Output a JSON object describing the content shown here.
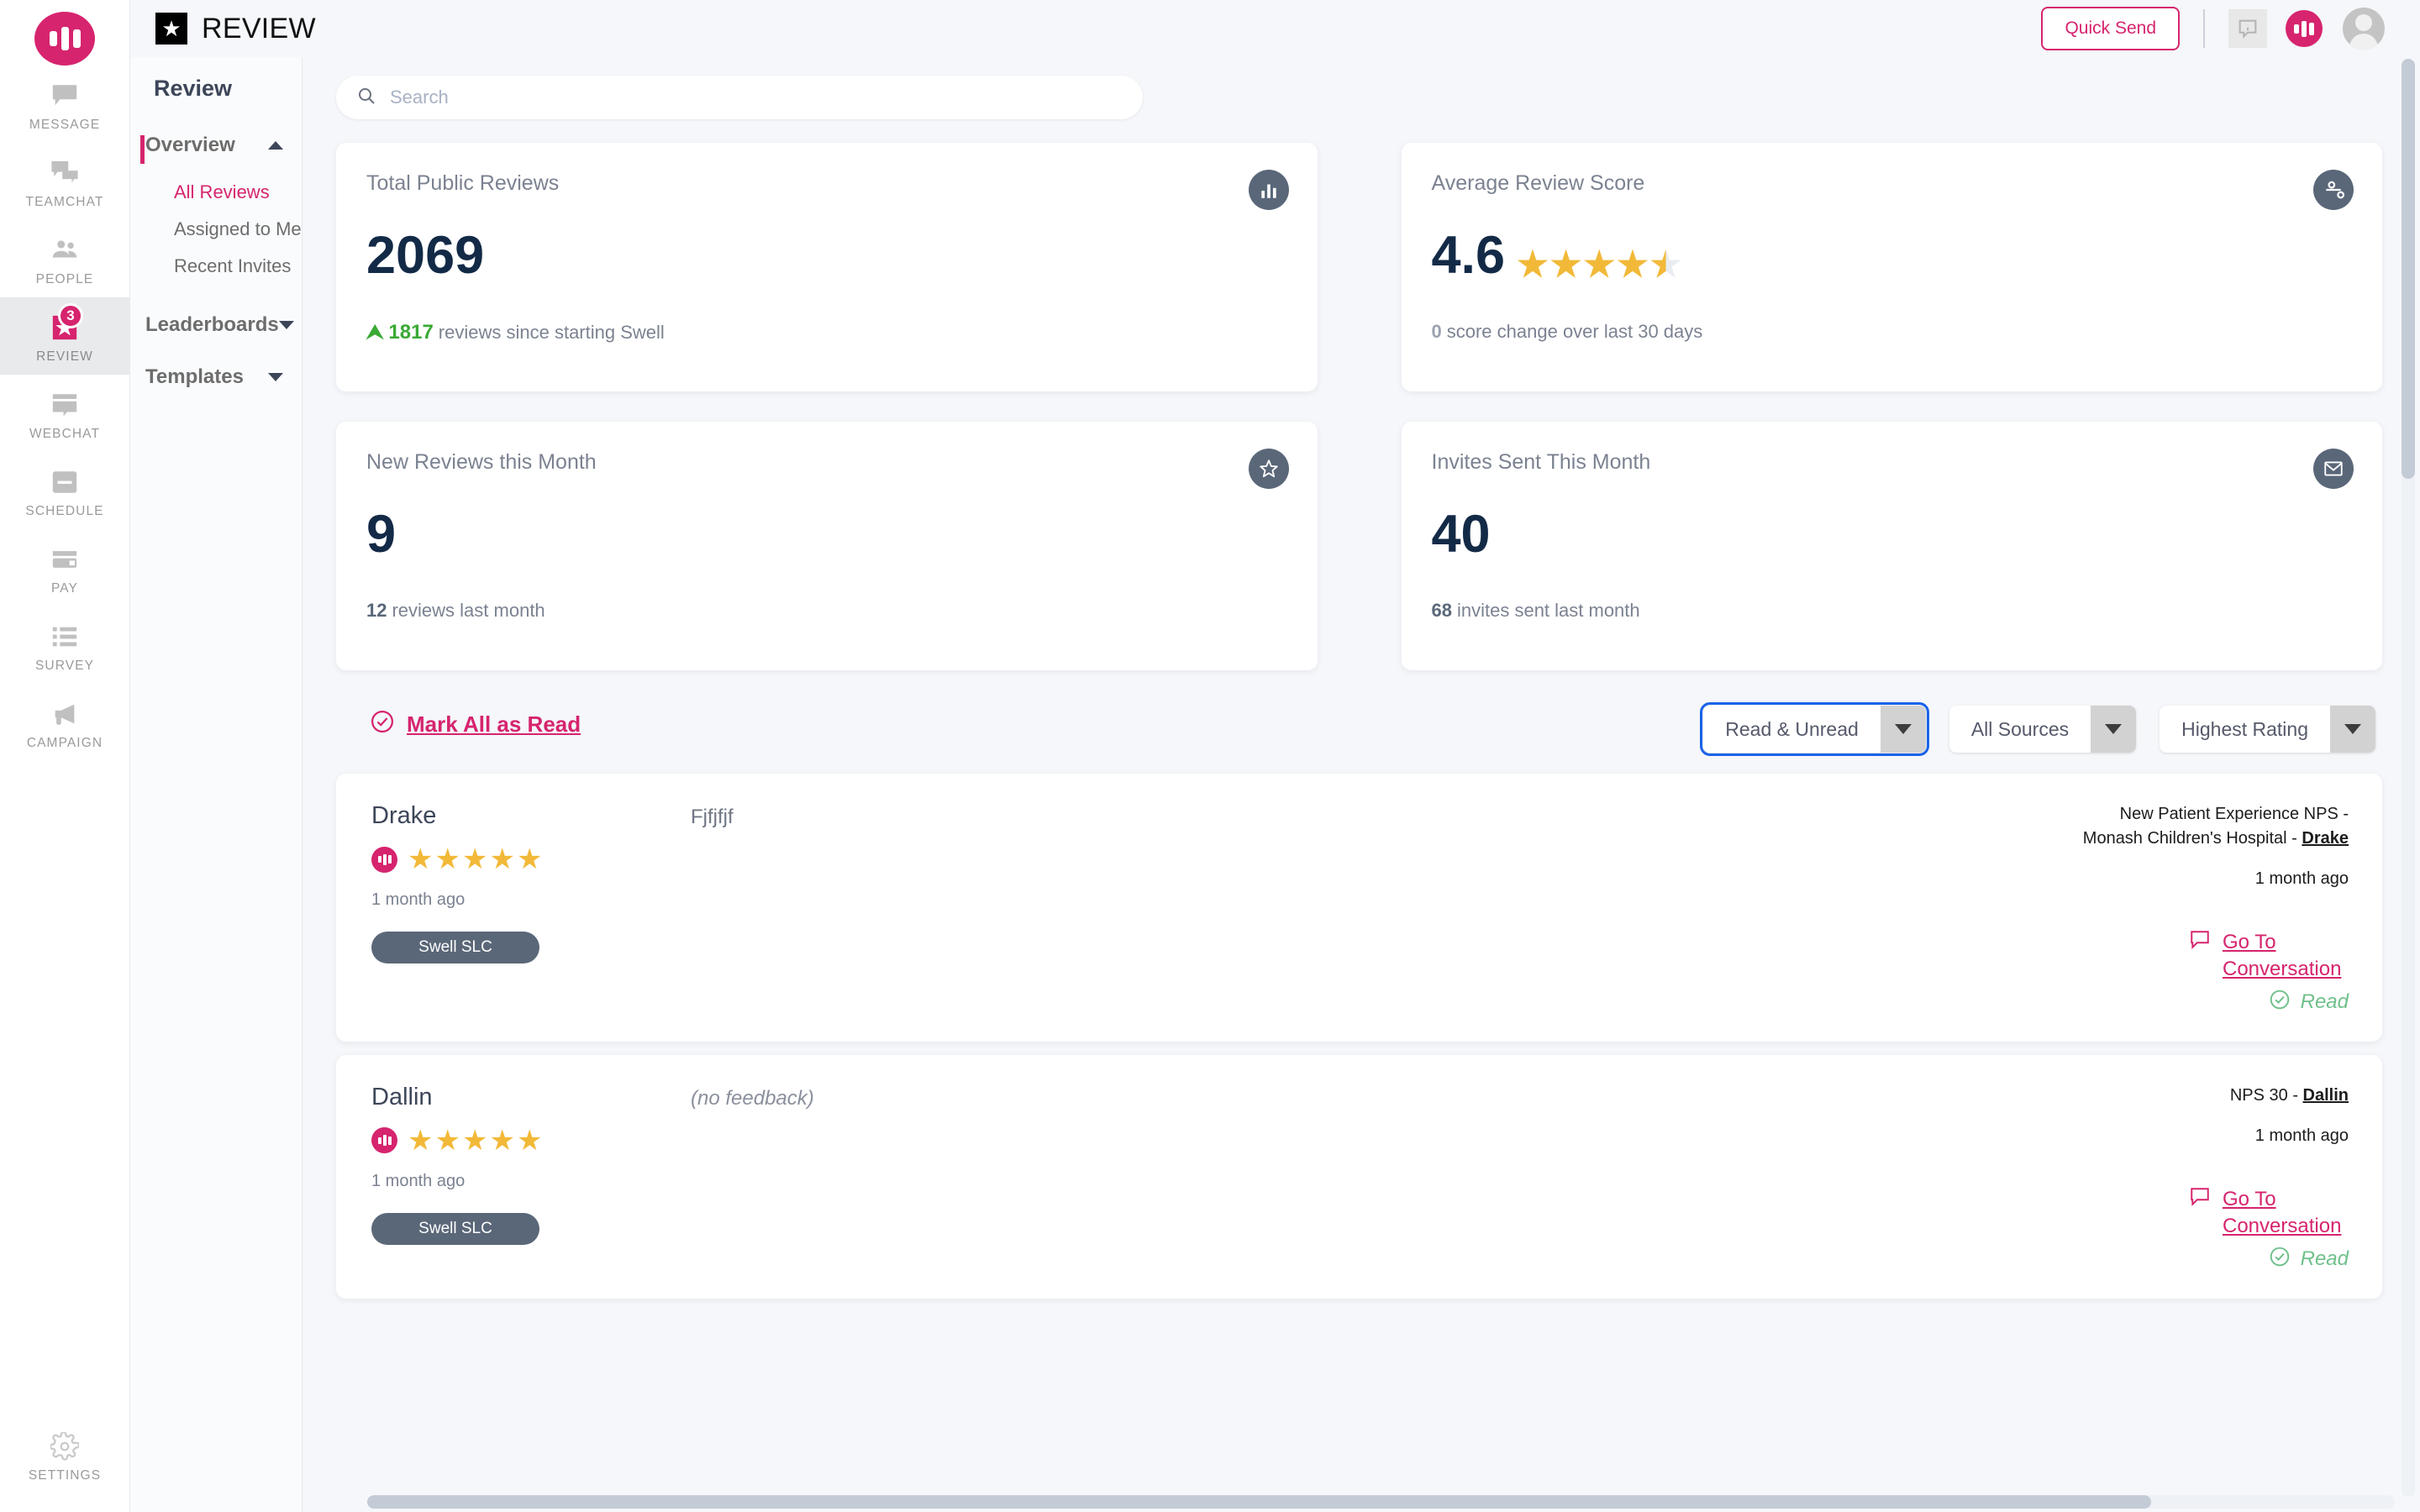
{
  "rail": {
    "logo": "swell-logo",
    "items": [
      {
        "label": "MESSAGE",
        "icon": "message-icon",
        "active": false,
        "badge": null
      },
      {
        "label": "TEAMCHAT",
        "icon": "teamchat-icon",
        "active": false,
        "badge": null
      },
      {
        "label": "PEOPLE",
        "icon": "people-icon",
        "active": false,
        "badge": null
      },
      {
        "label": "REVIEW",
        "icon": "star-review-icon",
        "active": true,
        "badge": "3"
      },
      {
        "label": "WEBCHAT",
        "icon": "webchat-icon",
        "active": false,
        "badge": null
      },
      {
        "label": "SCHEDULE",
        "icon": "calendar-icon",
        "active": false,
        "badge": null
      },
      {
        "label": "PAY",
        "icon": "credit-card-icon",
        "active": false,
        "badge": null
      },
      {
        "label": "SURVEY",
        "icon": "list-icon",
        "active": false,
        "badge": null
      },
      {
        "label": "CAMPAIGN",
        "icon": "megaphone-icon",
        "active": false,
        "badge": null
      }
    ],
    "settings": {
      "label": "SETTINGS",
      "icon": "gear-icon"
    }
  },
  "topbar": {
    "brand_icon": "star-badge-icon",
    "brand_title": "REVIEW",
    "quick_send": "Quick Send",
    "info_icon": "info-bubble-icon",
    "logo_icon": "swell-logo-icon",
    "avatar_icon": "user-avatar"
  },
  "subnav": {
    "title": "Review",
    "groups": [
      {
        "label": "Overview",
        "expanded": true,
        "active": true,
        "caret": "chevron-up-icon",
        "children": [
          {
            "label": "All Reviews",
            "selected": true
          },
          {
            "label": "Assigned to Me",
            "selected": false
          },
          {
            "label": "Recent Invites",
            "selected": false
          }
        ]
      },
      {
        "label": "Leaderboards",
        "expanded": false,
        "active": false,
        "caret": "chevron-down-icon",
        "children": []
      },
      {
        "label": "Templates",
        "expanded": false,
        "active": false,
        "caret": "chevron-down-icon",
        "children": []
      }
    ]
  },
  "search": {
    "placeholder": "Search",
    "value": "",
    "icon": "search-icon"
  },
  "cards": [
    {
      "title": "Total Public Reviews",
      "value": "2069",
      "icon": "bar-chart-icon",
      "delta_arrow": "up-arrow-icon",
      "delta_value": "1817",
      "delta_text": "reviews since starting Swell",
      "delta_color": "#3aa935"
    },
    {
      "title": "Average Review Score",
      "value": "4.6",
      "icon": "average-score-icon",
      "stars_full": 4,
      "stars_half": 1,
      "delta_value": "0",
      "delta_text": "score change over last 30 days",
      "delta_color": "#9aa2b1"
    },
    {
      "title": "New Reviews this Month",
      "value": "9",
      "icon": "star-outline-icon",
      "delta_value": "12",
      "delta_text": "reviews last month",
      "delta_color": "#5a6779"
    },
    {
      "title": "Invites Sent This Month",
      "value": "40",
      "icon": "envelope-icon",
      "delta_value": "68",
      "delta_text": "invites sent last month",
      "delta_color": "#5a6779"
    }
  ],
  "filters": [
    {
      "name": "read-status-filter",
      "value": "Read & Unread",
      "focused": true
    },
    {
      "name": "source-filter",
      "value": "All Sources",
      "focused": false
    },
    {
      "name": "sort-filter",
      "value": "Highest Rating",
      "focused": false
    }
  ],
  "mark_all": {
    "label": "Mark All as Read",
    "icon": "check-circle-icon"
  },
  "reviews": [
    {
      "name": "Drake",
      "source_icon": "swell-source-icon",
      "stars": 5,
      "ago": "1 month ago",
      "location": "Swell SLC",
      "feedback": "Fjfjfjf",
      "feedback_empty": false,
      "meta_prefix": "New Patient Experience NPS - Monash Children's Hospital - ",
      "meta_name": "Drake",
      "meta_ago": "1 month ago",
      "goto_label": "Go To Conversation",
      "goto_icon": "speech-bubble-icon",
      "status": "Read",
      "status_icon": "check-circle-icon"
    },
    {
      "name": "Dallin",
      "source_icon": "swell-source-icon",
      "stars": 5,
      "ago": "1 month ago",
      "location": "Swell SLC",
      "feedback": "(no feedback)",
      "feedback_empty": true,
      "meta_prefix": "NPS 30 - ",
      "meta_name": "Dallin",
      "meta_ago": "1 month ago",
      "goto_label": "Go To Conversation",
      "goto_icon": "speech-bubble-icon",
      "status": "Read",
      "status_icon": "check-circle-icon"
    }
  ],
  "colors": {
    "accent": "#d6246e",
    "dark": "#132a47",
    "slate": "#5a6779",
    "star": "#f2b938",
    "green": "#6fc08a"
  }
}
